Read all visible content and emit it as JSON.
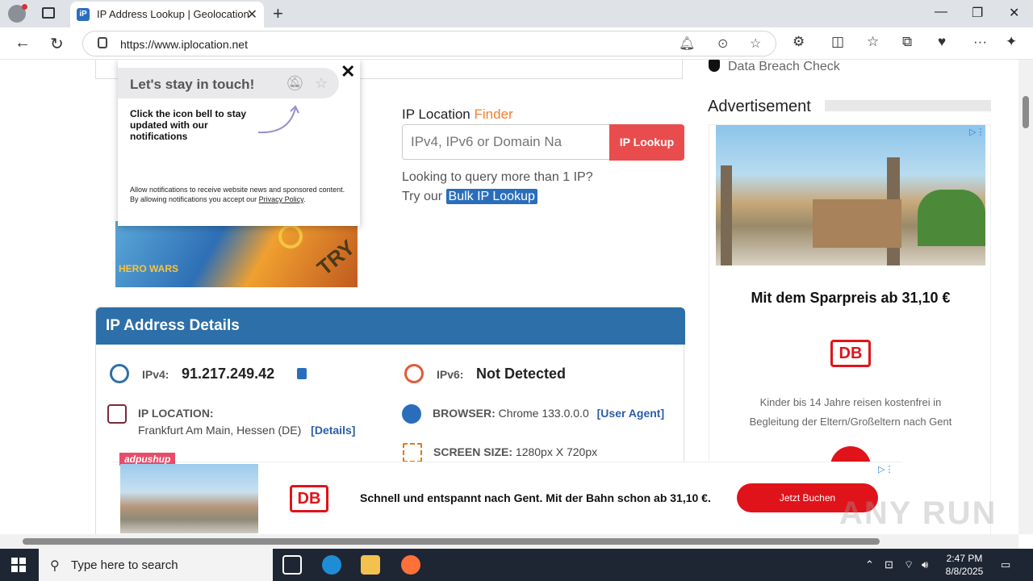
{
  "tab": {
    "title": "IP Address Lookup | Geolocation",
    "favicon": "iP"
  },
  "address_bar": {
    "url": "https://www.iplocation.net"
  },
  "notification_popup": {
    "headline": "Let's stay in touch!",
    "body": "Click the icon bell to stay updated with our notifications",
    "legal_prefix": "Allow notifications to receive website news and sponsored content. By allowing notifications you accept our ",
    "legal_link": "Privacy Policy",
    "legal_suffix": "."
  },
  "finder": {
    "label_main": "IP Location",
    "label_accent": "Finder",
    "placeholder": "IPv4, IPv6 or Domain Na",
    "button": "IP Lookup",
    "query_line": "Looking to query more than 1 IP?",
    "try_prefix": "Try our",
    "bulk_link": "Bulk IP Lookup"
  },
  "game_ad": {
    "logo": "HERO WARS",
    "cta": "TRY"
  },
  "details": {
    "heading": "IP Address Details",
    "ipv4_label": "IPv4:",
    "ipv4_value": "91.217.249.42",
    "ipv6_label": "IPv6:",
    "ipv6_value": "Not Detected",
    "location_label": "IP LOCATION:",
    "location_value": "Frankfurt Am Main, Hessen (DE)",
    "location_link": "[Details]",
    "browser_label": "BROWSER:",
    "browser_value": "Chrome 133.0.0.0",
    "browser_link": "[User Agent]",
    "screen_label": "SCREEN SIZE:",
    "screen_value": "1280px X 720px"
  },
  "sidebar": {
    "breach": "Data Breach Check",
    "adv_title": "Advertisement",
    "ad_headline": "Mit dem Sparpreis ab 31,10 €",
    "ad_logo": "DB",
    "ad_sub_1": "Kinder bis 14 Jahre reisen kostenfrei in",
    "ad_sub_2": "Begleitung der Eltern/Großeltern nach Gent"
  },
  "sticky_ad": {
    "brand": "adpushup",
    "logo": "DB",
    "message": "Schnell und entspannt nach Gent. Mit der Bahn schon ab 31,10 €.",
    "cta": "Jetzt Buchen"
  },
  "watermark": "ANY RUN",
  "taskbar": {
    "search_placeholder": "Type here to search",
    "time": "2:47 PM",
    "date": "8/8/2025"
  },
  "colors": {
    "accent_blue": "#2d6fa8",
    "lookup_red": "#e94c4c",
    "db_red": "#e0131a",
    "finder_orange": "#f0812f"
  }
}
